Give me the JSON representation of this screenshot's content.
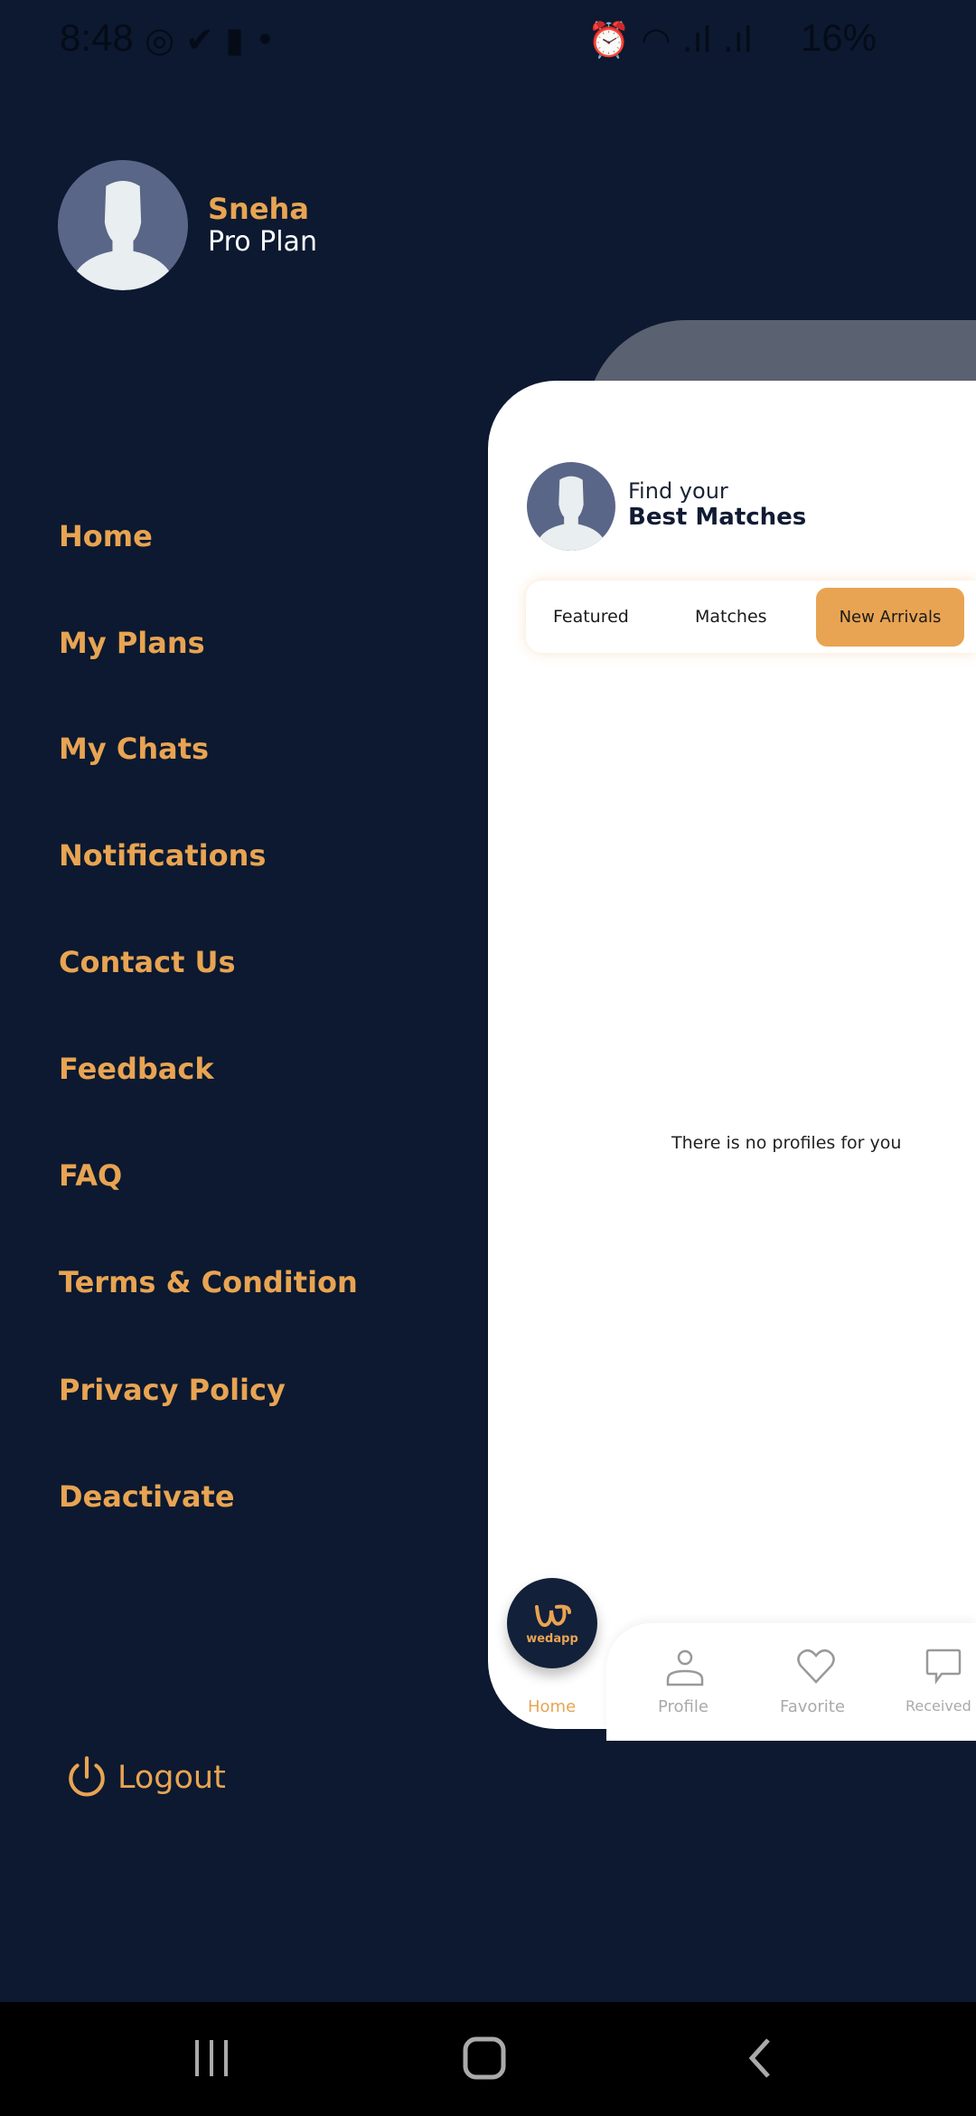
{
  "status_bar": {
    "time": "8:48",
    "battery": "16%",
    "icons": [
      "instagram-icon",
      "download-done-icon",
      "message-icon",
      "dot-icon",
      "alarm-icon",
      "wifi-icon",
      "lte1-signal-icon",
      "lte2-signal-icon",
      "battery-icon"
    ]
  },
  "user": {
    "name": "Sneha",
    "plan": "Pro Plan"
  },
  "menu": {
    "items": [
      {
        "label": "Home"
      },
      {
        "label": "My Plans"
      },
      {
        "label": "My Chats"
      },
      {
        "label": "Notifications"
      },
      {
        "label": "Contact Us"
      },
      {
        "label": "Feedback"
      },
      {
        "label": "FAQ"
      },
      {
        "label": "Terms & Condition"
      },
      {
        "label": "Privacy Policy"
      },
      {
        "label": "Deactivate"
      }
    ],
    "logout": "Logout"
  },
  "main": {
    "heading_line1": "Find your",
    "heading_line2": "Best Matches",
    "tabs": [
      {
        "label": "Featured"
      },
      {
        "label": "Matches"
      },
      {
        "label": "New Arrivals",
        "active": true
      }
    ],
    "empty_text": "There is no profiles for you"
  },
  "bottom_nav": {
    "logo": "wedapp",
    "items": [
      {
        "label": "Home",
        "active": true
      },
      {
        "label": "Profile"
      },
      {
        "label": "Favorite"
      },
      {
        "label": "Received"
      }
    ]
  },
  "colors": {
    "background": "#0c1930",
    "accent": "#e8a452",
    "card": "#ffffff"
  }
}
